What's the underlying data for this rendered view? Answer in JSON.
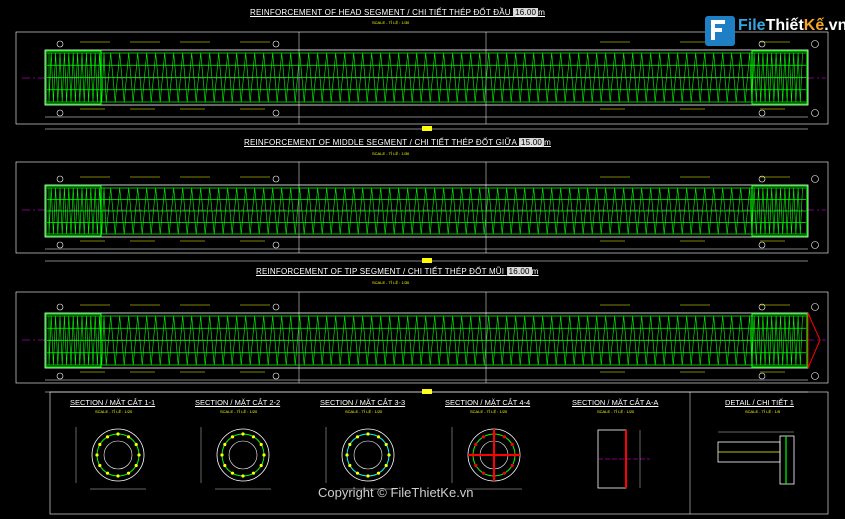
{
  "segments": [
    {
      "title": "REINFORCEMENT OF HEAD SEGMENT  / CHI TIẾT THÉP ĐỐT ĐẦU",
      "length": "16.00",
      "unit": "m",
      "scale": "SCALE - TỈ LỆ : 1/30"
    },
    {
      "title": "REINFORCEMENT OF MIDDLE SEGMENT  / CHI TIẾT THÉP ĐỐT GIỮA",
      "length": "15.00",
      "unit": "m",
      "scale": "SCALE - TỈ LỆ : 1/30"
    },
    {
      "title": "REINFORCEMENT OF TIP SEGMENT  / CHI TIẾT THÉP ĐỐT MŨI",
      "length": "16.00",
      "unit": "m",
      "scale": "SCALE - TỈ LỆ : 1/30"
    }
  ],
  "sections": [
    {
      "title": "SECTION / MẶT CẮT 1-1",
      "scale": "SCALE - TỈ LỆ : 1/20"
    },
    {
      "title": "SECTION / MẶT CẮT 2-2",
      "scale": "SCALE - TỈ LỆ : 1/20"
    },
    {
      "title": "SECTION / MẶT CẮT 3-3",
      "scale": "SCALE - TỈ LỆ : 1/20"
    },
    {
      "title": "SECTION / MẶT CẮT 4-4",
      "scale": "SCALE - TỈ LỆ : 1/20"
    },
    {
      "title": "SECTION / MẶT CẮT A-A",
      "scale": "SCALE - TỈ LỆ : 1/20"
    },
    {
      "title": "DETAIL / CHI TIẾT 1",
      "scale": "SCALE - TỈ LỆ : 1/5"
    }
  ],
  "logo": {
    "part1": "File",
    "part2": "Thiết",
    "part3": "Kế",
    "part4": ".vn"
  },
  "copyright": "Copyright © FileThietKe.vn",
  "colors": {
    "background": "#000000",
    "rebar": "#00ff00",
    "spiral": "#00ffff",
    "outline": "#ffffff",
    "label": "#ffff00",
    "axis": "#ff00ff",
    "accent": "#ff0000"
  }
}
